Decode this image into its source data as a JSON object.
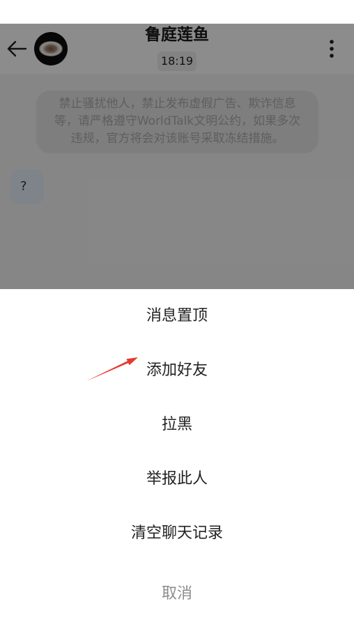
{
  "header": {
    "back_icon": "arrow-left-icon",
    "avatar_icon": "food-bowl-avatar",
    "title": "鲁庭莲鱼",
    "time": "18:19",
    "more_icon": "more-vertical-icon"
  },
  "chat": {
    "notice_lines": [
      "禁止骚扰他人，禁止发布虚假广告、欺诈信息",
      "等，请严格遵守WorldTalk文明公约，如果多次",
      "违规，官方将会对该账号采取冻结措施。"
    ],
    "messages": [
      {
        "text": "?"
      }
    ]
  },
  "action_sheet": {
    "items": [
      {
        "label": "消息置顶"
      },
      {
        "label": "添加好友"
      },
      {
        "label": "拉黑"
      },
      {
        "label": "举报此人"
      },
      {
        "label": "清空聊天记录"
      }
    ],
    "cancel_label": "取消"
  },
  "colors": {
    "annotation_arrow": "#e53a2f",
    "sheet_background": "#ffffff",
    "cancel_text": "#8c8c8c"
  }
}
